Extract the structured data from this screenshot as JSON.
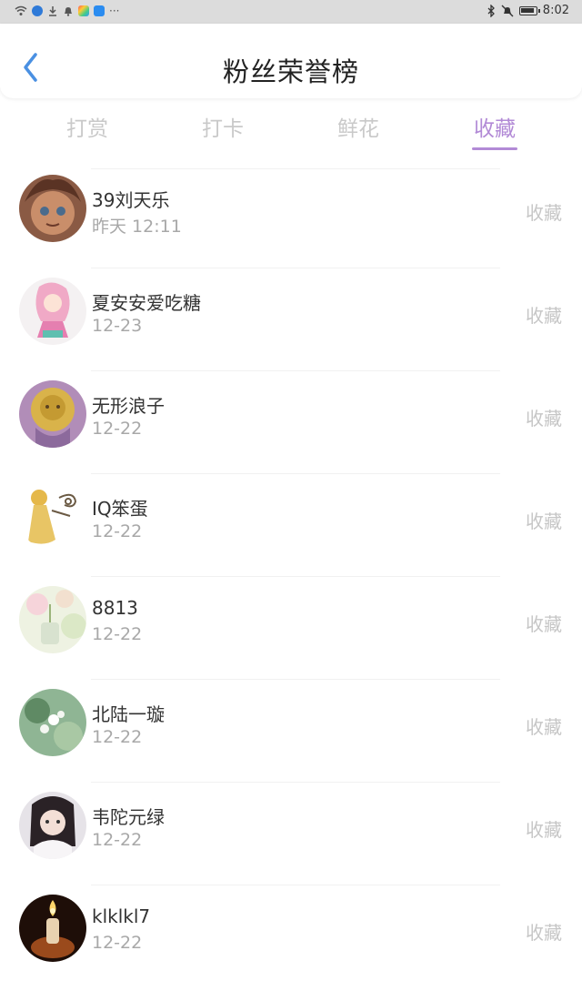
{
  "status_bar": {
    "time": "8:02",
    "left_icons": [
      "wifi-icon",
      "location-icon",
      "download-icon",
      "notification-bell-icon",
      "app-icon",
      "app-icon",
      "more-icon"
    ],
    "right_icons": [
      "bluetooth-icon",
      "mute-icon",
      "battery-icon"
    ]
  },
  "header": {
    "title": "粉丝荣誉榜",
    "back_icon": "chevron-left-icon",
    "accent_color": "#4a90e2"
  },
  "tabs": [
    {
      "label": "打赏",
      "active": false
    },
    {
      "label": "打卡",
      "active": false
    },
    {
      "label": "鲜花",
      "active": false
    },
    {
      "label": "收藏",
      "active": true
    }
  ],
  "tab_active_color": "#b28ad6",
  "fans": [
    {
      "name": "39刘天乐",
      "time": "昨天 12:11",
      "action": "收藏"
    },
    {
      "name": "夏安安爱吃糖",
      "time": "12-23",
      "action": "收藏"
    },
    {
      "name": "无形浪子",
      "time": "12-22",
      "action": "收藏"
    },
    {
      "name": "IQ笨蛋",
      "time": "12-22",
      "action": "收藏"
    },
    {
      "name": "8813",
      "time": "12-22",
      "action": "收藏"
    },
    {
      "name": "北陆一璇",
      "time": "12-22",
      "action": "收藏"
    },
    {
      "name": "韦陀元绿",
      "time": "12-22",
      "action": "收藏"
    },
    {
      "name": "klklkl7",
      "time": "12-22",
      "action": "收藏"
    }
  ]
}
